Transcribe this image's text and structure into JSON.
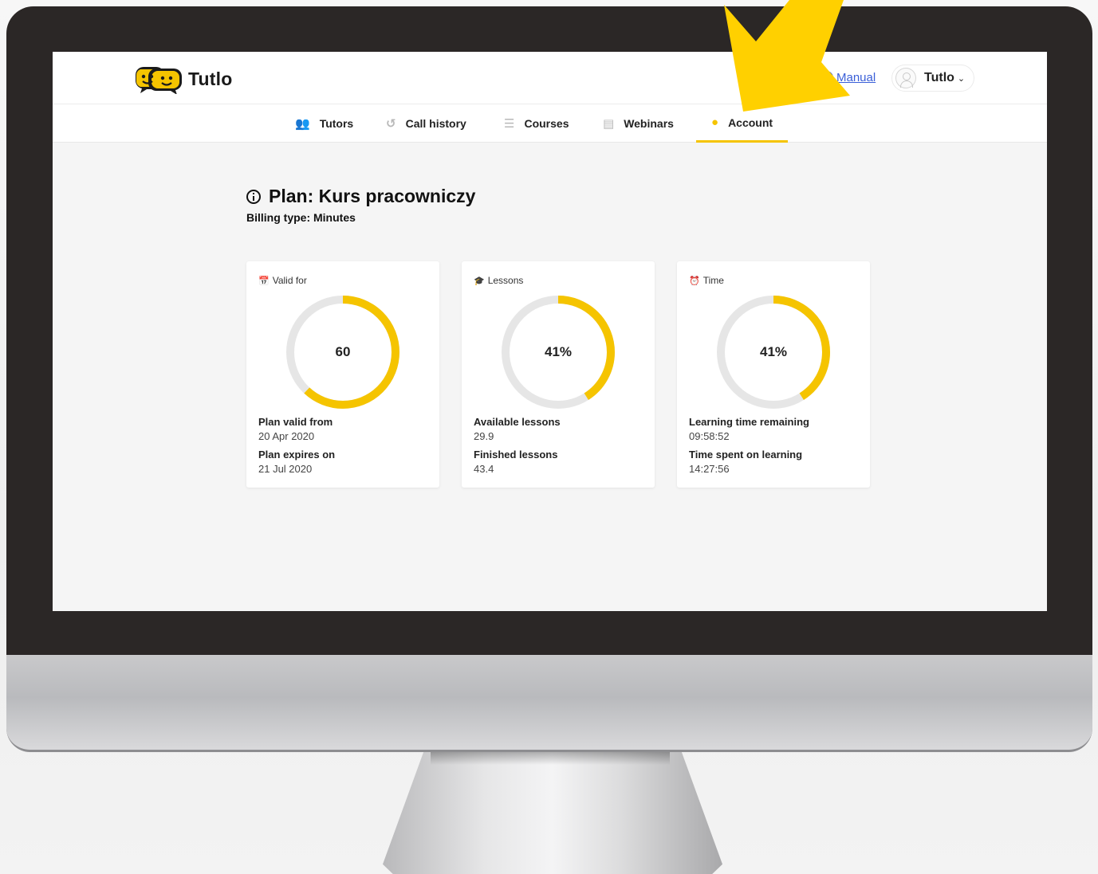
{
  "brand": {
    "name": "Tutlo",
    "accent": "#f5c400"
  },
  "header": {
    "manual_label": "Manual",
    "user_name": "Tutlo"
  },
  "nav": {
    "items": [
      {
        "label": "Tutors",
        "icon": "users-icon"
      },
      {
        "label": "Call history",
        "icon": "history-icon"
      },
      {
        "label": "Courses",
        "icon": "list-icon"
      },
      {
        "label": "Webinars",
        "icon": "webinar-icon"
      },
      {
        "label": "Account",
        "icon": "account-icon",
        "active": true
      }
    ]
  },
  "plan": {
    "title": "Plan: Kurs pracowniczy",
    "billing": "Billing type: Minutes"
  },
  "cards": [
    {
      "title": "Valid for",
      "icon": "calendar-icon",
      "center": "60",
      "progress": 0.62,
      "stats": [
        {
          "label": "Plan valid from",
          "value": "20 Apr 2020"
        },
        {
          "label": "Plan expires on",
          "value": "21 Jul 2020"
        }
      ]
    },
    {
      "title": "Lessons",
      "icon": "graduation-cap-icon",
      "center": "41%",
      "progress": 0.41,
      "stats": [
        {
          "label": "Available lessons",
          "value": "29.9"
        },
        {
          "label": "Finished lessons",
          "value": "43.4"
        }
      ]
    },
    {
      "title": "Time",
      "icon": "alarm-clock-icon",
      "center": "41%",
      "progress": 0.41,
      "stats": [
        {
          "label": "Learning time remaining",
          "value": "09:58:52"
        },
        {
          "label": "Time spent on learning",
          "value": "14:27:56"
        }
      ]
    }
  ]
}
